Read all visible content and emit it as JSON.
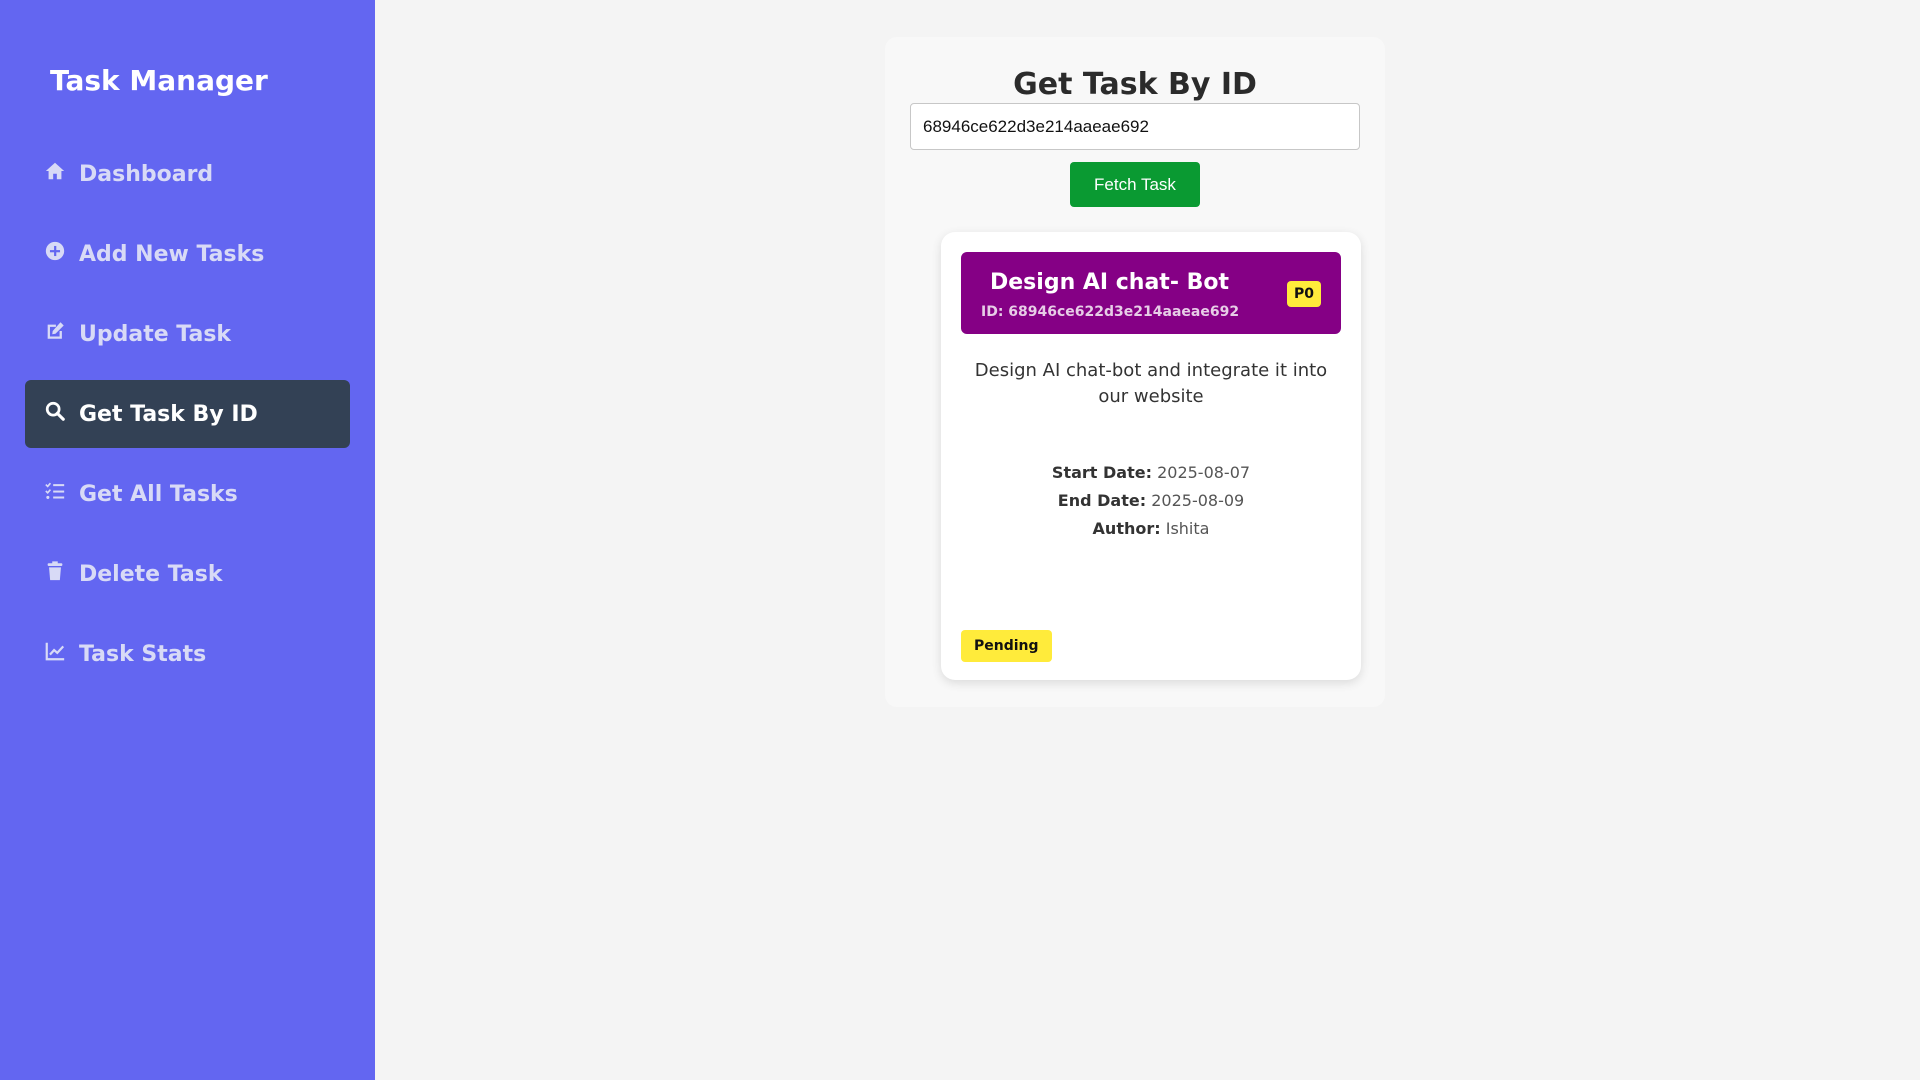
{
  "app": {
    "title": "Task Manager"
  },
  "sidebar": {
    "items": [
      {
        "label": "Dashboard",
        "icon": "home-icon",
        "active": false
      },
      {
        "label": "Add New Tasks",
        "icon": "plus-circle-icon",
        "active": false
      },
      {
        "label": "Update Task",
        "icon": "edit-icon",
        "active": false
      },
      {
        "label": "Get Task By ID",
        "icon": "search-icon",
        "active": true
      },
      {
        "label": "Get All Tasks",
        "icon": "list-check-icon",
        "active": false
      },
      {
        "label": "Delete Task",
        "icon": "trash-icon",
        "active": false
      },
      {
        "label": "Task Stats",
        "icon": "chart-line-icon",
        "active": false
      }
    ]
  },
  "main": {
    "title": "Get Task By ID",
    "input": {
      "value": "68946ce622d3e214aaeae692"
    },
    "fetch_button": "Fetch Task",
    "task": {
      "title": "Design AI chat- Bot",
      "id_text": "ID: 68946ce622d3e214aaeae692",
      "priority": "P0",
      "description": "Design AI chat-bot and integrate it into our website",
      "start_label": "Start Date:",
      "start_date": "2025-08-07",
      "end_label": "End Date:",
      "end_date": "2025-08-09",
      "author_label": "Author:",
      "author": "Ishita",
      "status": "Pending"
    }
  },
  "colors": {
    "sidebar": "#6366f1",
    "active_item": "#334155",
    "fetch_button": "#0a9a32",
    "task_header": "#850085",
    "badge": "#ffeb3b"
  }
}
